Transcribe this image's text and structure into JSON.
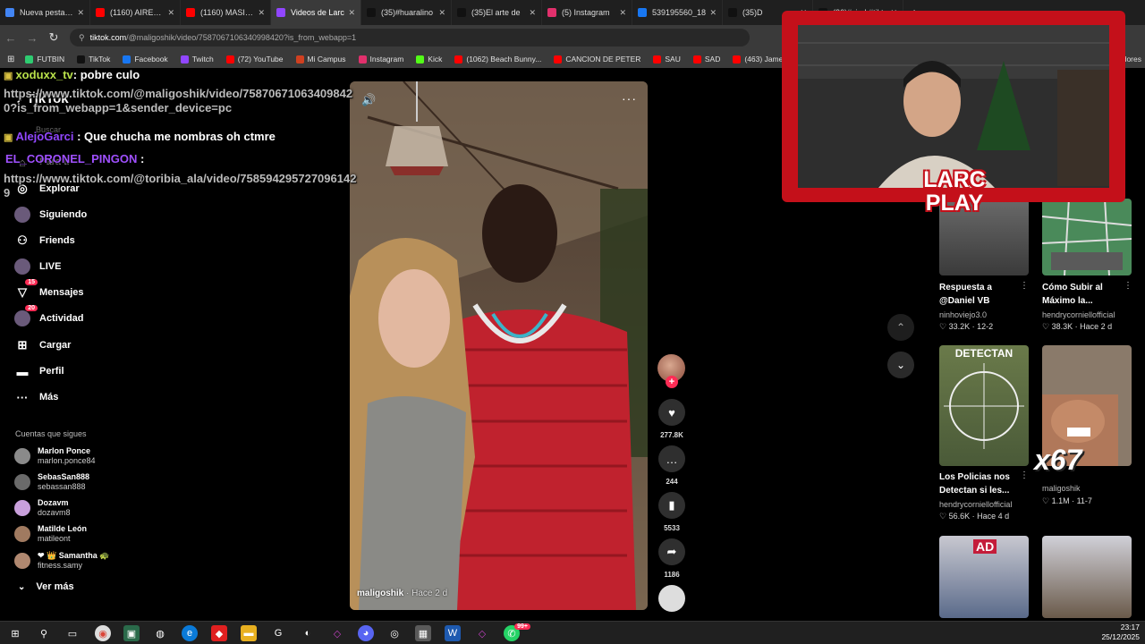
{
  "browser": {
    "tabs": [
      {
        "label": "Nueva pestaña",
        "color": "#4285f4"
      },
      {
        "label": "(1160) AIRES D",
        "color": "#ff0000"
      },
      {
        "label": "(1160) MASIEL",
        "color": "#ff0000"
      },
      {
        "label": "Videos de Larc",
        "color": "#9146ff"
      },
      {
        "label": "(35)#huaralino",
        "color": "#111111"
      },
      {
        "label": "(35)El arte de",
        "color": "#111111"
      },
      {
        "label": "(5) Instagram",
        "color": "#e1306c"
      },
      {
        "label": "539195560_18",
        "color": "#1877f2"
      },
      {
        "label": "(35)D",
        "color": "#111111"
      },
      {
        "label": "(36)#viral #tikt",
        "color": "#111111"
      }
    ],
    "new_tab": "+",
    "url_domain": "tiktok.com",
    "url_path": "/@maligoshik/video/7587067106340998420?is_from_webapp=1",
    "bookmarks": [
      {
        "label": "FUTBIN",
        "color": "#2ecc71"
      },
      {
        "label": "TikTok",
        "color": "#111111"
      },
      {
        "label": "Facebook",
        "color": "#1877f2"
      },
      {
        "label": "Twitch",
        "color": "#9146ff"
      },
      {
        "label": "(72) YouTube",
        "color": "#ff0000"
      },
      {
        "label": "Mi Campus",
        "color": "#d04020"
      },
      {
        "label": "Instagram",
        "color": "#e1306c"
      },
      {
        "label": "Kick",
        "color": "#53fc18"
      },
      {
        "label": "(1062) Beach Bunny...",
        "color": "#ff0000"
      },
      {
        "label": "CANCION DE PETER",
        "color": "#ff0000"
      },
      {
        "label": "SAU",
        "color": "#ff0000"
      },
      {
        "label": "SAD",
        "color": "#ff0000"
      },
      {
        "label": "(463) James Arthur -...",
        "color": "#ff0000"
      }
    ],
    "bookmarks_right": "adores"
  },
  "sidebar": {
    "logo": "TikTok",
    "search_placeholder": "Buscar",
    "nav": [
      {
        "label": "Para ti",
        "icon": "home-icon",
        "glyph": "⌂"
      },
      {
        "label": "Explorar",
        "icon": "compass-icon",
        "glyph": "◎"
      },
      {
        "label": "Siguiendo",
        "icon": "following-icon",
        "glyph": "●"
      },
      {
        "label": "Friends",
        "icon": "friends-icon",
        "glyph": "⚇"
      },
      {
        "label": "LIVE",
        "icon": "live-icon",
        "glyph": "●"
      },
      {
        "label": "Mensajes",
        "icon": "messages-icon",
        "glyph": "▽",
        "badge": "15"
      },
      {
        "label": "Actividad",
        "icon": "activity-icon",
        "glyph": "●",
        "badge": "20"
      },
      {
        "label": "Cargar",
        "icon": "upload-icon",
        "glyph": "⊞"
      },
      {
        "label": "Perfil",
        "icon": "profile-icon",
        "glyph": "▬"
      },
      {
        "label": "Más",
        "icon": "more-icon",
        "glyph": "···"
      }
    ],
    "following_title": "Cuentas que sigues",
    "following": [
      {
        "name": "Marlon Ponce",
        "handle": "marlon.ponce84",
        "color": "#8a8a8a"
      },
      {
        "name": "SebasSan888",
        "handle": "sebassan888",
        "color": "#6a6a6a"
      },
      {
        "name": "Dozavm",
        "handle": "dozavm8",
        "color": "#c9a0dc"
      },
      {
        "name": "Matilde León",
        "handle": "matileont",
        "color": "#a07a60"
      },
      {
        "name": "❤ 👑 Samantha 🐢",
        "handle": "fitness.samy",
        "color": "#b08870"
      }
    ],
    "see_more": "Ver más"
  },
  "chat": [
    {
      "user": "xoduxx_tv",
      "sep": ": ",
      "text": "pobre culo"
    },
    {
      "user": "",
      "sep": "",
      "text": "https://www.tiktok.com/@maligoshik/video/758706710634098420?is_from_webapp=1&sender_device=pc"
    },
    {
      "user": "AlejoGarci",
      "sep": " : ",
      "text": "Que chucha me nombras oh ctmre"
    },
    {
      "user": "EL_CORONEL_PINGON",
      "sep": " :",
      "text": ""
    },
    {
      "user": "",
      "sep": "",
      "text": "https://www.tiktok.com/@toribia_ala/video/7585942957270961429"
    }
  ],
  "video": {
    "author": "maligoshik",
    "time": " · Hace 2 d",
    "mute_icon": "🔊",
    "more_icon": "···"
  },
  "actions": {
    "likes": "277.8K",
    "comments": "244",
    "saves": "5533",
    "shares": "1186",
    "follow_plus": "+"
  },
  "overlay": {
    "brand_line1": "LARC",
    "brand_line2": "PLAY"
  },
  "suggestions": {
    "cards": [
      {
        "title": "Respuesta a @Daniel VB",
        "user": "ninhoviejo3.0",
        "likes": "♡ 33.2K",
        "date": "12-2"
      },
      {
        "title": "Cómo Subir al Máximo la...",
        "user": "hendrycorniellofficial",
        "likes": "♡ 38.3K",
        "date": "Hace 2 d"
      },
      {
        "title": "Los Policias nos Detectan si les...",
        "user": "hendrycorniellofficial",
        "likes": "♡ 56.6K",
        "date": "Hace 4 d",
        "thumb_text": "DETECTAN"
      },
      {
        "title": "",
        "user": "maligoshik",
        "likes": "♡ 1.1M",
        "date": "11-7",
        "thumb_text": "x67"
      },
      {
        "title": "",
        "user": "",
        "likes": "",
        "date": "",
        "thumb_text": "AD"
      },
      {
        "title": "",
        "user": "",
        "likes": "",
        "date": ""
      }
    ]
  },
  "taskbar": {
    "time": "23:17",
    "date": "25/12/2025",
    "whatsapp_badge": "99+"
  }
}
